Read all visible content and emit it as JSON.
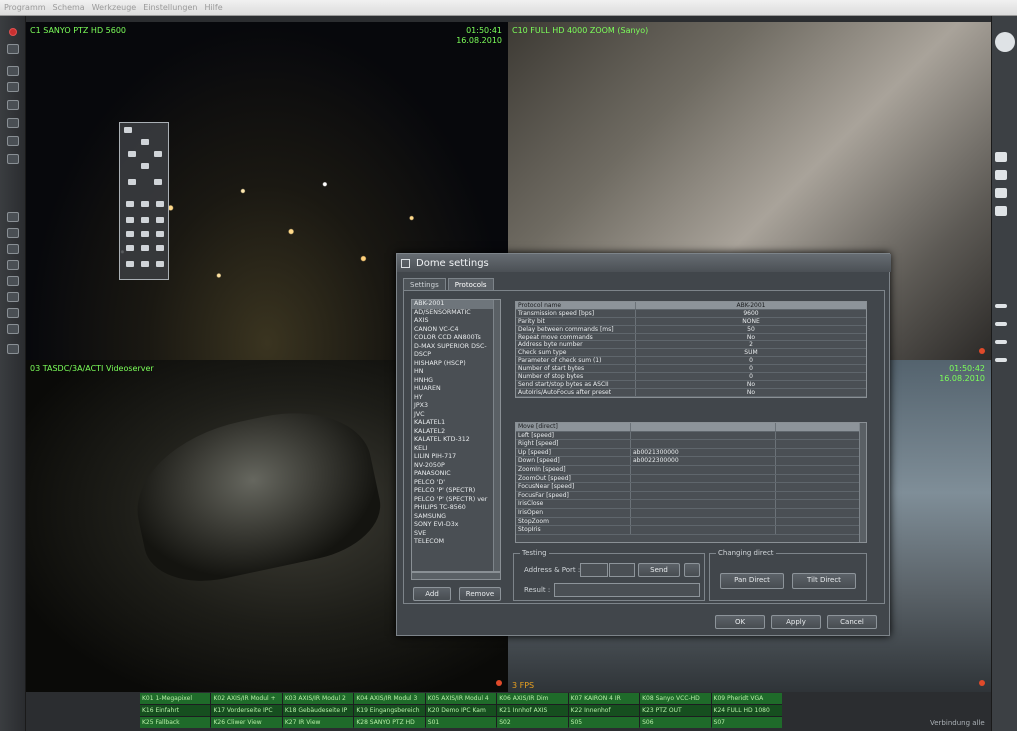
{
  "menu": [
    "Programm",
    "Schema",
    "Werkzeuge",
    "Einstellungen",
    "Hilfe"
  ],
  "cameras": {
    "cam1": {
      "name": "C1 SANYO PTZ HD 5600",
      "time": "01:50:41",
      "date": "16.08.2010"
    },
    "cam2": {
      "name": "C10 FULL HD 4000 ZOOM (Sanyo)"
    },
    "cam3": {
      "name": "03 TASDC/3A/ACTI Videoserver"
    },
    "cam4": {
      "time": "01:50:42",
      "date": "16.08.2010"
    },
    "fps": "3 FPS"
  },
  "dialog": {
    "title": "Dome settings",
    "tabs": [
      "Settings",
      "Protocols"
    ],
    "protocols": [
      "ABK-2001",
      "AD/SENSORMATIC",
      "AXIS",
      "CANON VC-C4",
      "COLOR CCD AN800Ts",
      "D-MAX SUPERIOR DSC-",
      "DSCP",
      "HISHARP (HSCP)",
      "HN",
      "HNHG",
      "HUAREN",
      "HY",
      "JPX3",
      "JVC",
      "KALATEL1",
      "KALATEL2",
      "KALATEL KTD-312",
      "KELI",
      "LILIN PIH-717",
      "NV-2050P",
      "PANASONIC",
      "PELCO 'D'",
      "PELCO 'P' (SPECTR)",
      "PELCO 'P' (SPECTR) ver",
      "PHILIPS TC-8560",
      "SAMSUNG",
      "SONY EVI-D3x",
      "SVE",
      "TELECOM"
    ],
    "add_label": "Add",
    "remove_label": "Remove",
    "params_header": {
      "k": "Protocol name",
      "v": "ABK-2001"
    },
    "params": [
      {
        "k": "Transmission speed [bps]",
        "v": "9600"
      },
      {
        "k": "Parity bit",
        "v": "NONE"
      },
      {
        "k": "Delay between commands [ms]",
        "v": "50"
      },
      {
        "k": "Repeat move commands",
        "v": "No"
      },
      {
        "k": "Address byte number",
        "v": "2"
      },
      {
        "k": "Check sum type",
        "v": "SUM"
      },
      {
        "k": "Parameter of check sum (1)",
        "v": "0"
      },
      {
        "k": "Number of start bytes",
        "v": "0"
      },
      {
        "k": "Number of stop bytes",
        "v": "0"
      },
      {
        "k": "Send start/stop bytes as ASCII",
        "v": "No"
      },
      {
        "k": "AutoIris/AutoFocus after preset",
        "v": "No"
      }
    ],
    "commands_header": "Move [direct]",
    "commands": [
      {
        "c1": "Left [speed]",
        "c2": ""
      },
      {
        "c1": "Right [speed]",
        "c2": ""
      },
      {
        "c1": "Up [speed]",
        "c2": "ab0021300000"
      },
      {
        "c1": "Down [speed]",
        "c2": "ab0022300000"
      },
      {
        "c1": "ZoomIn [speed]",
        "c2": ""
      },
      {
        "c1": "ZoomOut [speed]",
        "c2": ""
      },
      {
        "c1": "FocusNear [speed]",
        "c2": ""
      },
      {
        "c1": "FocusFar [speed]",
        "c2": ""
      },
      {
        "c1": "IrisClose",
        "c2": ""
      },
      {
        "c1": "IrisOpen",
        "c2": ""
      },
      {
        "c1": "StopZoom",
        "c2": ""
      },
      {
        "c1": "StopIris",
        "c2": ""
      }
    ],
    "testing": {
      "group": "Testing",
      "address_label": "Address & Port :",
      "send_label": "Send",
      "result_label": "Result :"
    },
    "direct": {
      "group": "Changing direct",
      "pan_label": "Pan Direct",
      "tilt_label": "Tilt Direct"
    },
    "ok_label": "OK",
    "apply_label": "Apply",
    "cancel_label": "Cancel"
  },
  "strip": [
    "K01 1-Megapixel",
    "K02 AXIS/IR Modul +",
    "K03 AXIS/IR Modul 2",
    "K04 AXIS/IR Modul 3",
    "K05 AXIS/IR Modul 4",
    "K06 AXIS/IR Dim",
    "K07 KAIRON 4 IR",
    "K08 Sanyo VCC-HD",
    "K09 Pheridt VGA",
    "K16 Einfahrt",
    "K17 Vorderseite IPC",
    "K18 Gebäudeseite IP",
    "K19 Eingangsbereich",
    "K20 Demo IPC Kam",
    "K21 Innhof AXIS",
    "K22 Innenhof",
    "K23 PTZ OUT",
    "K24 FULL HD 1080",
    "K25 Fallback",
    "K26 Cliwer View",
    "K27 IR View",
    "K28 SANYO PTZ HD",
    "S01",
    "S02",
    "S05",
    "S06",
    "S07"
  ],
  "status_text": "Verbindung alle"
}
